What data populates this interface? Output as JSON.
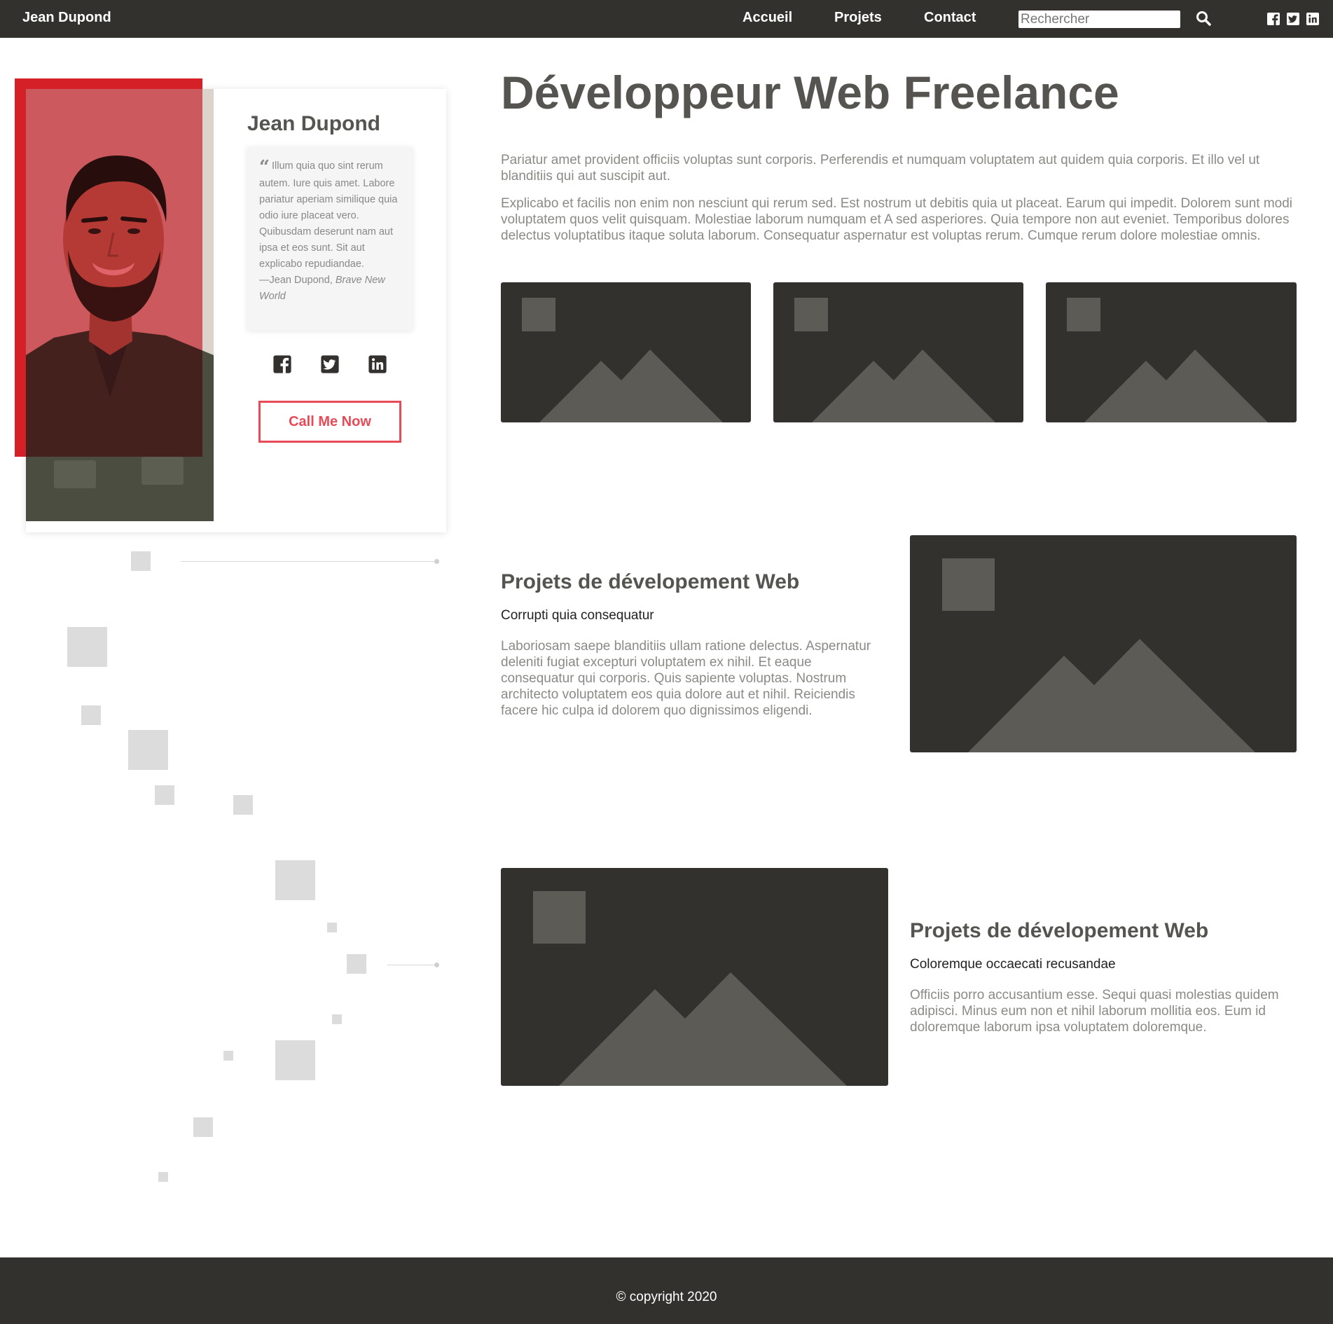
{
  "navbar": {
    "brand": "Jean Dupond",
    "links": [
      "Accueil",
      "Projets",
      "Contact"
    ],
    "search_placeholder": "Rechercher",
    "social_icons": [
      "facebook-icon",
      "twitter-icon",
      "linkedin-icon"
    ]
  },
  "profile": {
    "name": "Jean Dupond",
    "quote": "Illum quia quo sint rerum autem. Iure quis amet. Labore pariatur aperiam similique quia odio iure placeat vero. Quibusdam deserunt nam aut ipsa et eos sunt. Sit aut explicabo repudiandae.",
    "quote_author": "—Jean Dupond,",
    "quote_source": "Brave New World",
    "social_icons": [
      "facebook-icon",
      "twitter-icon",
      "linkedin-icon"
    ],
    "cta": "Call Me Now",
    "accent_color": "#e84b57"
  },
  "main": {
    "title": "Développeur Web Freelance",
    "paragraphs": [
      "Pariatur amet provident officiis voluptas sunt corporis. Perferendis et numquam voluptatem aut quidem quia corporis. Et illo vel ut blanditiis qui aut suscipit aut.",
      "Explicabo et facilis non enim non nesciunt qui rerum sed. Est nostrum ut debitis quia ut placeat. Earum qui impedit. Dolorem sunt modi voluptatem quos velit quisquam. Molestiae laborum numquam et A sed asperiores. Quia tempore non aut eveniet. Temporibus dolores delectus voluptatibus itaque soluta laborum. Consequatur aspernatur est voluptas rerum. Cumque rerum dolore molestiae omnis."
    ]
  },
  "projects": [
    {
      "title": "Projets de dévelopement Web",
      "subtitle": "Corrupti quia consequatur",
      "text": "Laboriosam saepe blanditiis ullam ratione delectus. Aspernatur deleniti fugiat excepturi voluptatem ex nihil. Et eaque consequatur qui corporis. Quis sapiente voluptas. Nostrum architecto voluptatem eos quia dolore aut et nihil. Reiciendis facere hic culpa id dolorem quo dignissimos eligendi."
    },
    {
      "title": "Projets de dévelopement Web",
      "subtitle": "Coloremque occaecati recusandae",
      "text": "Officiis porro accusantium esse. Sequi quasi molestias quidem adipisci. Minus eum non et nihil laborum mollitia eos. Eum id doloremque laborum ipsa voluptatem doloremque."
    }
  ],
  "footer": {
    "copyright": "© copyright 2020"
  },
  "colors": {
    "dark": "#32312d",
    "heading": "#555450",
    "muted": "#8b8a86",
    "decor": "#dcdcdc"
  }
}
